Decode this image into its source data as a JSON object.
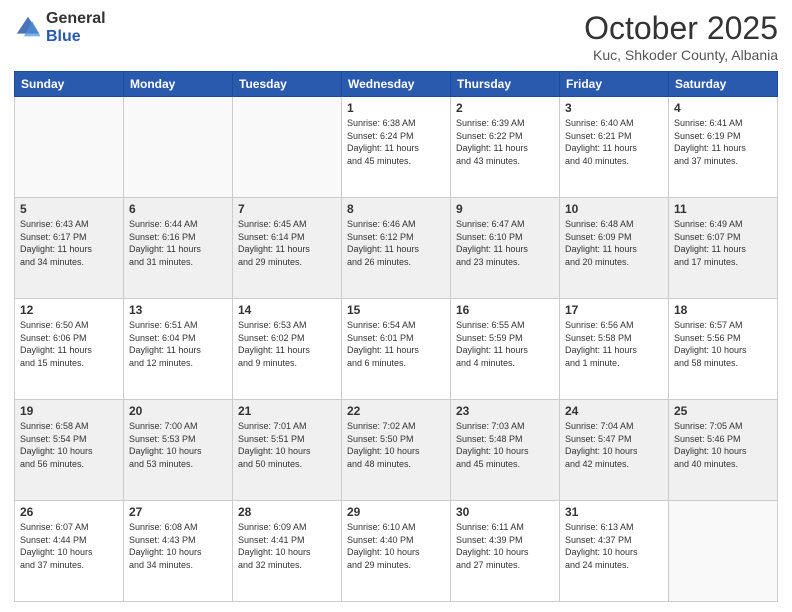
{
  "header": {
    "logo_general": "General",
    "logo_blue": "Blue",
    "month_title": "October 2025",
    "location": "Kuc, Shkoder County, Albania"
  },
  "weekdays": [
    "Sunday",
    "Monday",
    "Tuesday",
    "Wednesday",
    "Thursday",
    "Friday",
    "Saturday"
  ],
  "rows": [
    {
      "shaded": false,
      "cells": [
        {
          "day": "",
          "info": ""
        },
        {
          "day": "",
          "info": ""
        },
        {
          "day": "",
          "info": ""
        },
        {
          "day": "1",
          "info": "Sunrise: 6:38 AM\nSunset: 6:24 PM\nDaylight: 11 hours\nand 45 minutes."
        },
        {
          "day": "2",
          "info": "Sunrise: 6:39 AM\nSunset: 6:22 PM\nDaylight: 11 hours\nand 43 minutes."
        },
        {
          "day": "3",
          "info": "Sunrise: 6:40 AM\nSunset: 6:21 PM\nDaylight: 11 hours\nand 40 minutes."
        },
        {
          "day": "4",
          "info": "Sunrise: 6:41 AM\nSunset: 6:19 PM\nDaylight: 11 hours\nand 37 minutes."
        }
      ]
    },
    {
      "shaded": true,
      "cells": [
        {
          "day": "5",
          "info": "Sunrise: 6:43 AM\nSunset: 6:17 PM\nDaylight: 11 hours\nand 34 minutes."
        },
        {
          "day": "6",
          "info": "Sunrise: 6:44 AM\nSunset: 6:16 PM\nDaylight: 11 hours\nand 31 minutes."
        },
        {
          "day": "7",
          "info": "Sunrise: 6:45 AM\nSunset: 6:14 PM\nDaylight: 11 hours\nand 29 minutes."
        },
        {
          "day": "8",
          "info": "Sunrise: 6:46 AM\nSunset: 6:12 PM\nDaylight: 11 hours\nand 26 minutes."
        },
        {
          "day": "9",
          "info": "Sunrise: 6:47 AM\nSunset: 6:10 PM\nDaylight: 11 hours\nand 23 minutes."
        },
        {
          "day": "10",
          "info": "Sunrise: 6:48 AM\nSunset: 6:09 PM\nDaylight: 11 hours\nand 20 minutes."
        },
        {
          "day": "11",
          "info": "Sunrise: 6:49 AM\nSunset: 6:07 PM\nDaylight: 11 hours\nand 17 minutes."
        }
      ]
    },
    {
      "shaded": false,
      "cells": [
        {
          "day": "12",
          "info": "Sunrise: 6:50 AM\nSunset: 6:06 PM\nDaylight: 11 hours\nand 15 minutes."
        },
        {
          "day": "13",
          "info": "Sunrise: 6:51 AM\nSunset: 6:04 PM\nDaylight: 11 hours\nand 12 minutes."
        },
        {
          "day": "14",
          "info": "Sunrise: 6:53 AM\nSunset: 6:02 PM\nDaylight: 11 hours\nand 9 minutes."
        },
        {
          "day": "15",
          "info": "Sunrise: 6:54 AM\nSunset: 6:01 PM\nDaylight: 11 hours\nand 6 minutes."
        },
        {
          "day": "16",
          "info": "Sunrise: 6:55 AM\nSunset: 5:59 PM\nDaylight: 11 hours\nand 4 minutes."
        },
        {
          "day": "17",
          "info": "Sunrise: 6:56 AM\nSunset: 5:58 PM\nDaylight: 11 hours\nand 1 minute."
        },
        {
          "day": "18",
          "info": "Sunrise: 6:57 AM\nSunset: 5:56 PM\nDaylight: 10 hours\nand 58 minutes."
        }
      ]
    },
    {
      "shaded": true,
      "cells": [
        {
          "day": "19",
          "info": "Sunrise: 6:58 AM\nSunset: 5:54 PM\nDaylight: 10 hours\nand 56 minutes."
        },
        {
          "day": "20",
          "info": "Sunrise: 7:00 AM\nSunset: 5:53 PM\nDaylight: 10 hours\nand 53 minutes."
        },
        {
          "day": "21",
          "info": "Sunrise: 7:01 AM\nSunset: 5:51 PM\nDaylight: 10 hours\nand 50 minutes."
        },
        {
          "day": "22",
          "info": "Sunrise: 7:02 AM\nSunset: 5:50 PM\nDaylight: 10 hours\nand 48 minutes."
        },
        {
          "day": "23",
          "info": "Sunrise: 7:03 AM\nSunset: 5:48 PM\nDaylight: 10 hours\nand 45 minutes."
        },
        {
          "day": "24",
          "info": "Sunrise: 7:04 AM\nSunset: 5:47 PM\nDaylight: 10 hours\nand 42 minutes."
        },
        {
          "day": "25",
          "info": "Sunrise: 7:05 AM\nSunset: 5:46 PM\nDaylight: 10 hours\nand 40 minutes."
        }
      ]
    },
    {
      "shaded": false,
      "cells": [
        {
          "day": "26",
          "info": "Sunrise: 6:07 AM\nSunset: 4:44 PM\nDaylight: 10 hours\nand 37 minutes."
        },
        {
          "day": "27",
          "info": "Sunrise: 6:08 AM\nSunset: 4:43 PM\nDaylight: 10 hours\nand 34 minutes."
        },
        {
          "day": "28",
          "info": "Sunrise: 6:09 AM\nSunset: 4:41 PM\nDaylight: 10 hours\nand 32 minutes."
        },
        {
          "day": "29",
          "info": "Sunrise: 6:10 AM\nSunset: 4:40 PM\nDaylight: 10 hours\nand 29 minutes."
        },
        {
          "day": "30",
          "info": "Sunrise: 6:11 AM\nSunset: 4:39 PM\nDaylight: 10 hours\nand 27 minutes."
        },
        {
          "day": "31",
          "info": "Sunrise: 6:13 AM\nSunset: 4:37 PM\nDaylight: 10 hours\nand 24 minutes."
        },
        {
          "day": "",
          "info": ""
        }
      ]
    }
  ]
}
